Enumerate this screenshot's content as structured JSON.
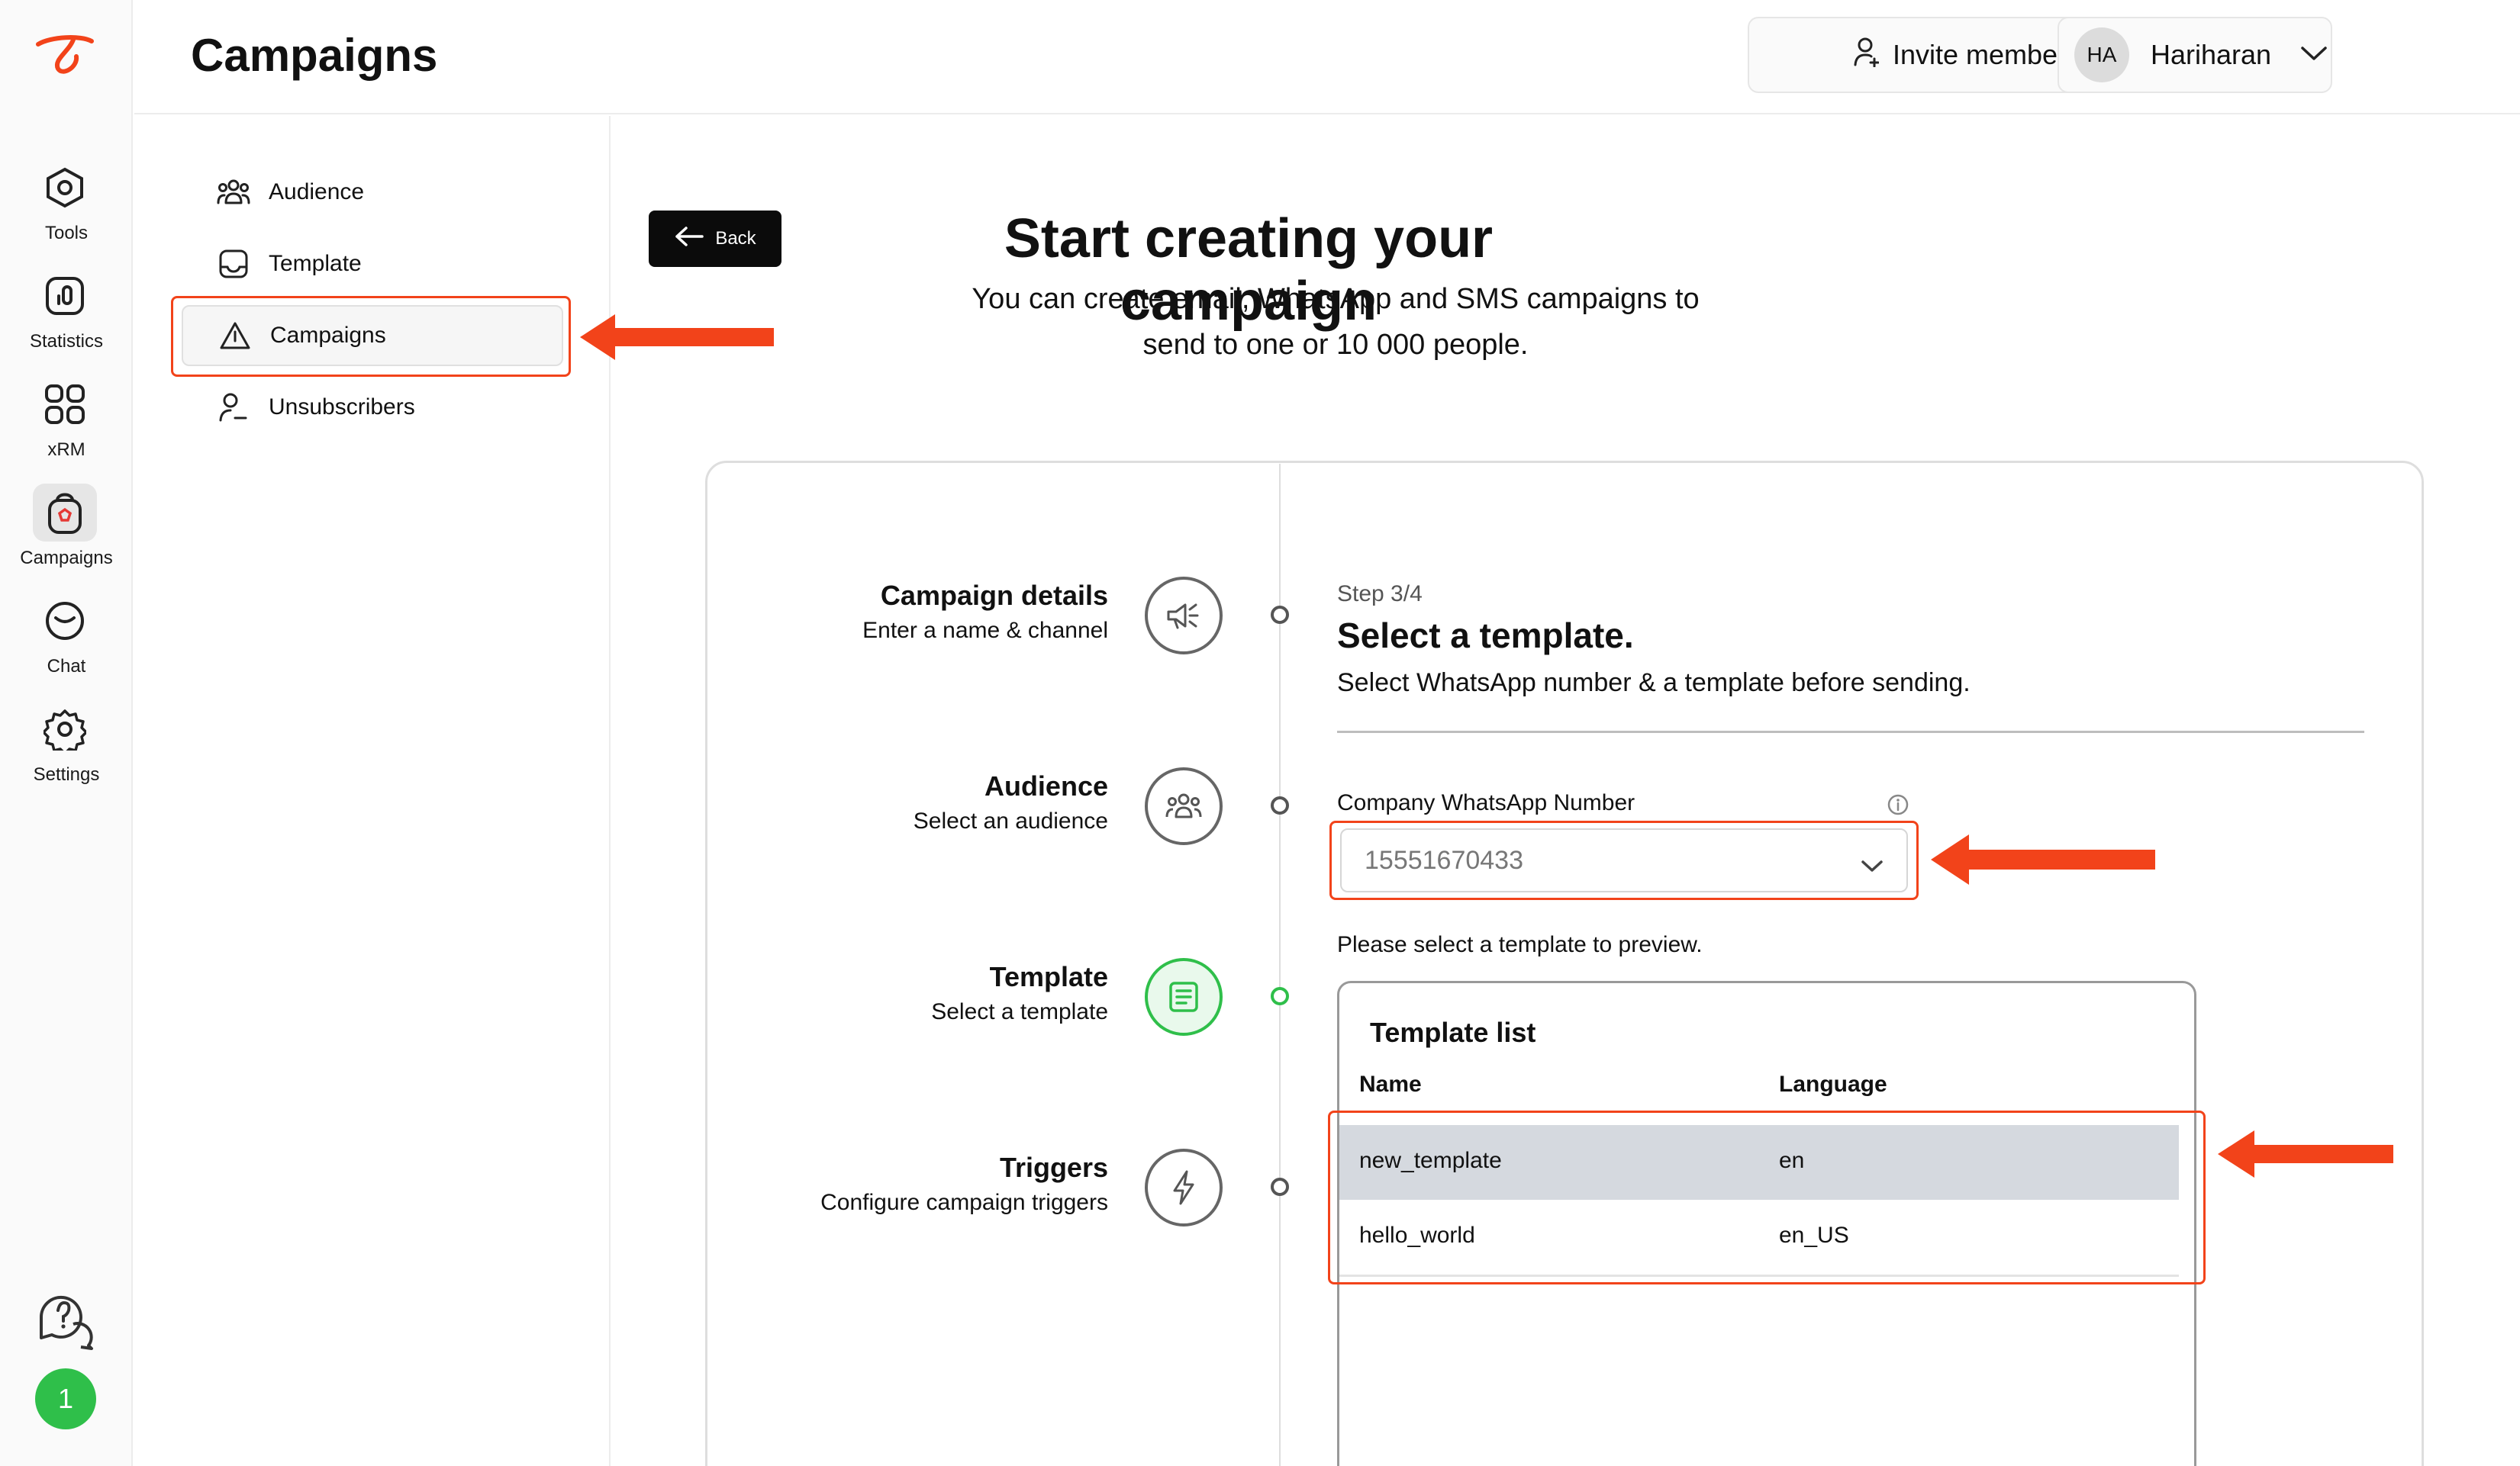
{
  "header": {
    "title": "Campaigns",
    "invite_label": "Invite member",
    "user_initials": "HA",
    "user_name": "Hariharan"
  },
  "rail": {
    "items": [
      {
        "label": "Tools"
      },
      {
        "label": "Statistics"
      },
      {
        "label": "xRM"
      },
      {
        "label": "Campaigns"
      },
      {
        "label": "Chat"
      },
      {
        "label": "Settings"
      }
    ],
    "notification_count": "1"
  },
  "subnav": {
    "items": [
      {
        "label": "Audience"
      },
      {
        "label": "Template"
      },
      {
        "label": "Campaigns"
      },
      {
        "label": "Unsubscribers"
      }
    ]
  },
  "main": {
    "back_label": "Back",
    "hero_title": "Start creating your campaign",
    "hero_line1": "You can create email, WhatsApp and SMS campaigns to",
    "hero_line2": "send to one or 10 000 people.",
    "steps": [
      {
        "title": "Campaign details",
        "desc": "Enter a name & channel"
      },
      {
        "title": "Audience",
        "desc": "Select an audience"
      },
      {
        "title": "Template",
        "desc": "Select a template"
      },
      {
        "title": "Triggers",
        "desc": "Configure campaign triggers"
      }
    ],
    "step_counter": "Step 3/4",
    "form_title": "Select a template.",
    "form_subtitle": "Select WhatsApp number & a template before sending.",
    "whatsapp_label": "Company WhatsApp Number",
    "whatsapp_value": "15551670433",
    "preview_hint": "Please select a template to preview.",
    "template_list": {
      "title": "Template list",
      "columns": [
        "Name",
        "Language"
      ],
      "rows": [
        {
          "name": "new_template",
          "language": "en"
        },
        {
          "name": "hello_world",
          "language": "en_US"
        }
      ]
    }
  },
  "colors": {
    "accent_red": "#f2431a",
    "active_green": "#2fbf4a",
    "selected_row": "#d5d9df"
  }
}
